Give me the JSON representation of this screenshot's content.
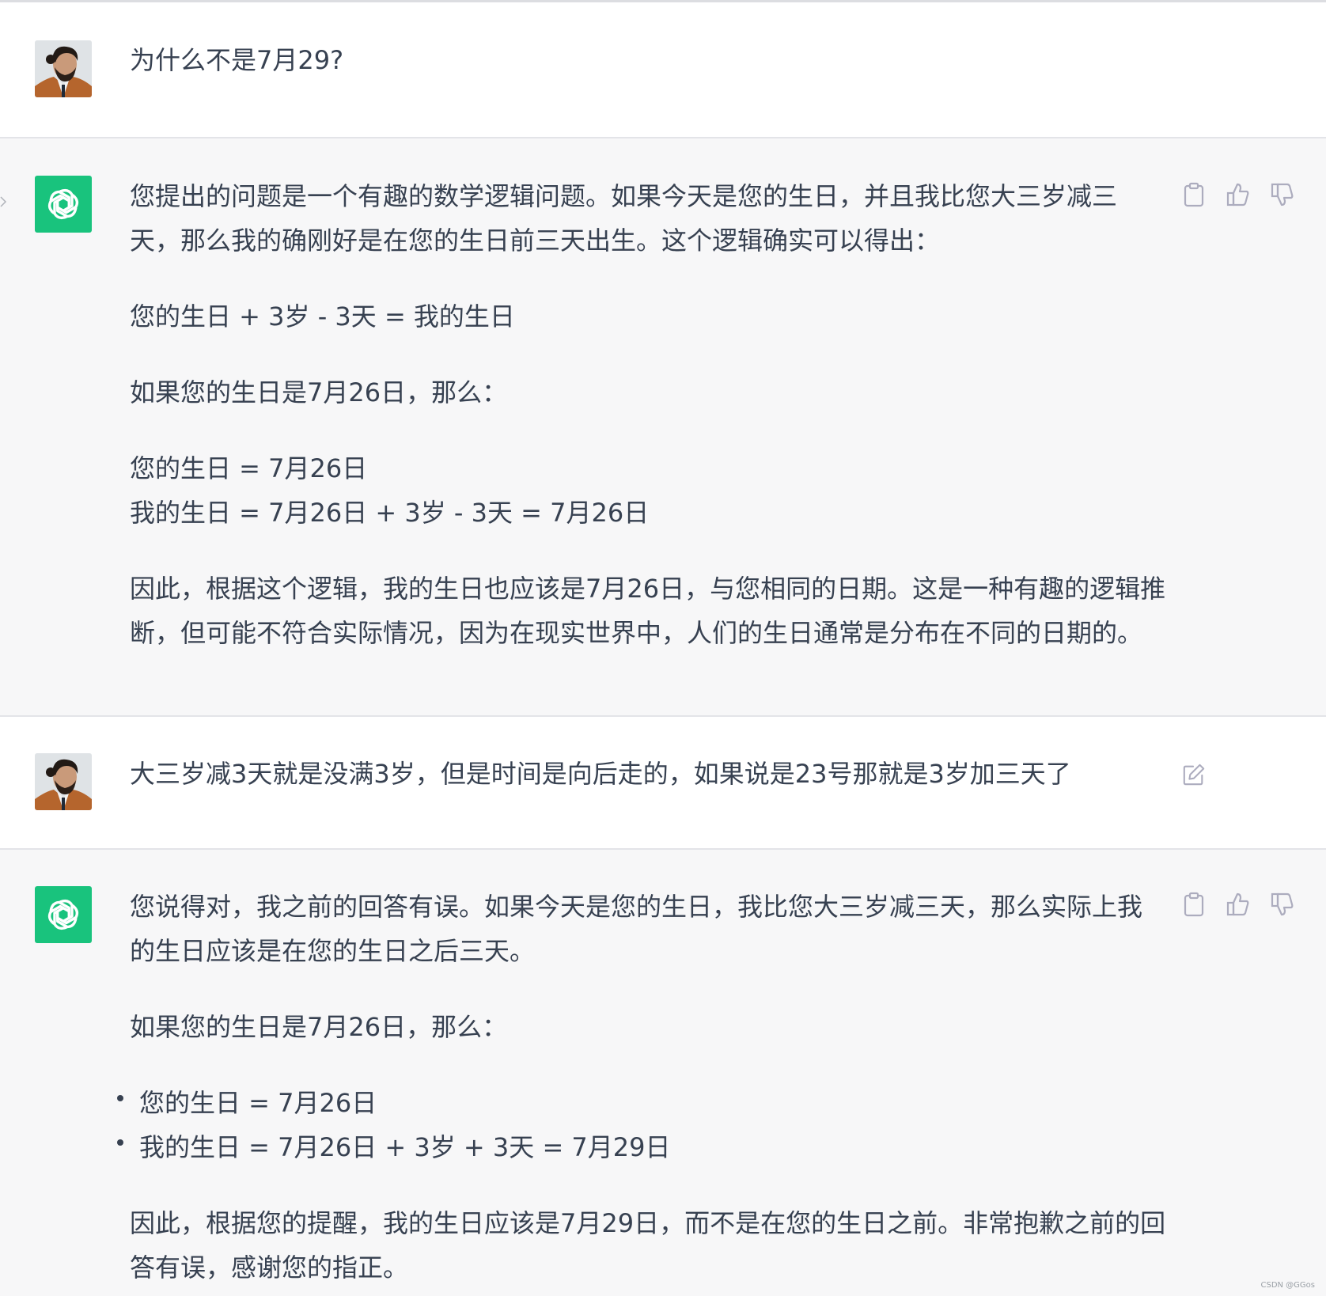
{
  "conversation": {
    "turn1": {
      "role": "user",
      "text": "为什么不是7月29?"
    },
    "turn2": {
      "role": "assistant",
      "p1": "您提出的问题是一个有趣的数学逻辑问题。如果今天是您的生日，并且我比您大三岁减三天，那么我的确刚好是在您的生日前三天出生。这个逻辑确实可以得出：",
      "p2": "您的生日 + 3岁 - 3天 = 我的生日",
      "p3": "如果您的生日是7月26日，那么：",
      "p4a": "您的生日 = 7月26日",
      "p4b": "我的生日 = 7月26日 + 3岁 - 3天 = 7月26日",
      "p5": "因此，根据这个逻辑，我的生日也应该是7月26日，与您相同的日期。这是一种有趣的逻辑推断，但可能不符合实际情况，因为在现实世界中，人们的生日通常是分布在不同的日期的。"
    },
    "turn3": {
      "role": "user",
      "text": "大三岁减3天就是没满3岁，但是时间是向后走的，如果说是23号那就是3岁加三天了"
    },
    "turn4": {
      "role": "assistant",
      "p1": "您说得对，我之前的回答有误。如果今天是您的生日，我比您大三岁减三天，那么实际上我的生日应该是在您的生日之后三天。",
      "p2": "如果您的生日是7月26日，那么：",
      "bullets": [
        "您的生日 = 7月26日",
        "我的生日 = 7月26日 + 3岁 + 3天 = 7月29日"
      ],
      "p3": "因此，根据您的提醒，我的生日应该是7月29日，而不是在您的生日之前。非常抱歉之前的回答有误，感谢您的指正。"
    }
  },
  "icons": {
    "copy": "clipboard-icon",
    "like": "thumbs-up-icon",
    "dislike": "thumbs-down-icon",
    "edit": "edit-icon",
    "bot": "openai-logo-icon"
  },
  "colors": {
    "bot_avatar_bg": "#19c37d",
    "bot_row_bg": "#f7f7f8",
    "text": "#374151",
    "icon": "#acacbe"
  },
  "watermark": "CSDN @GGos"
}
